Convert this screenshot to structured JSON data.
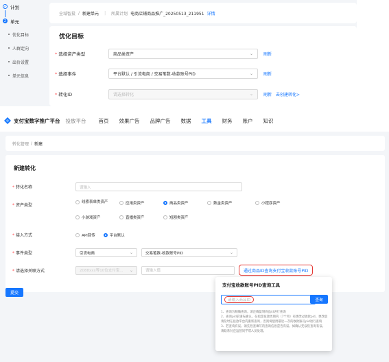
{
  "top": {
    "steps": [
      {
        "num": "",
        "title": "计划"
      },
      {
        "num": "2",
        "title": "单元"
      }
    ],
    "substeps": [
      "优化目标",
      "人群定向",
      "出价设置",
      "单元信息"
    ],
    "plan_bar": {
      "crumb_1": "全域智投",
      "crumb_sep": "/",
      "crumb_2": "新建单元",
      "plan_label": "所属计划",
      "plan_name": "电商店铺商品推广_20250513_211951",
      "detail_link": "详情"
    },
    "optimization": {
      "title": "优化目标",
      "rows": [
        {
          "label": "选择资产类型",
          "value": "商品类资产",
          "action": "刷新",
          "action2": ""
        },
        {
          "label": "选择事件",
          "value": "平台默认 / 引流电商 / 交易笔数-收款账号PID",
          "action": "刷新",
          "action2": ""
        },
        {
          "label": "转化ID",
          "value": "请选择转化",
          "action": "刷新",
          "action2": "去创建转化>"
        }
      ]
    }
  },
  "nav": {
    "brand": "支付宝数字推广平台",
    "sub": "投放平台",
    "items": [
      "首页",
      "效果广告",
      "品牌广告",
      "数据",
      "工具",
      "财务",
      "账户",
      "知识"
    ],
    "active_index": 4
  },
  "breadcrumb": {
    "parent": "转化管理",
    "sep": "/",
    "current": "新建"
  },
  "form": {
    "title": "新建转化",
    "name_label": "转化名称",
    "name_placeholder": "请输入",
    "asset_label": "资产类型",
    "asset_options": [
      {
        "label": "线索表单类资产",
        "selected": false
      },
      {
        "label": "应用类资产",
        "selected": false
      },
      {
        "label": "商品类资产",
        "selected": true
      },
      {
        "label": "数金类资产",
        "selected": false
      },
      {
        "label": "小程序资产",
        "selected": false
      },
      {
        "label": "小游戏资产",
        "selected": false
      },
      {
        "label": "直播类资产",
        "selected": false
      },
      {
        "label": "短剧类资产",
        "selected": false
      }
    ],
    "access_label": "接入方式",
    "access_options": [
      {
        "label": "API回传",
        "selected": false
      },
      {
        "label": "平台默认",
        "selected": true
      }
    ],
    "event_label": "事件类型",
    "event_value_1": "引流电商",
    "event_value_2": "交易笔数-收款账号PID",
    "related_label": "请选择关联方式",
    "related_select": "2088xxx等10位支付宝...",
    "related_input_placeholder": "请输入值",
    "query_link": "通过商品ID查询支付宝收款账号PID",
    "submit": "提交"
  },
  "popover": {
    "title": "支付宝收款账号PID查询工具",
    "input_placeholder": "请输入商品ID",
    "button": "查询",
    "notes": [
      "1、查询为精确查询，请正确复制商品id进行查询",
      "2、查询pid前请先确认，在指定投放周期内（7个月）有更改过收款pid，更改后请及时在投放平台内重新查询，否则将使用最近一次的收款账号pid进行查询",
      "3、若查询有误，请先检查填写的查询信息是否有误，如确认无误仍查询有误，请联系对应运营同学或人员处理。"
    ]
  },
  "colors": {
    "accent": "#1677ff",
    "highlight": "#e53935",
    "required": "#ff4d4f"
  }
}
